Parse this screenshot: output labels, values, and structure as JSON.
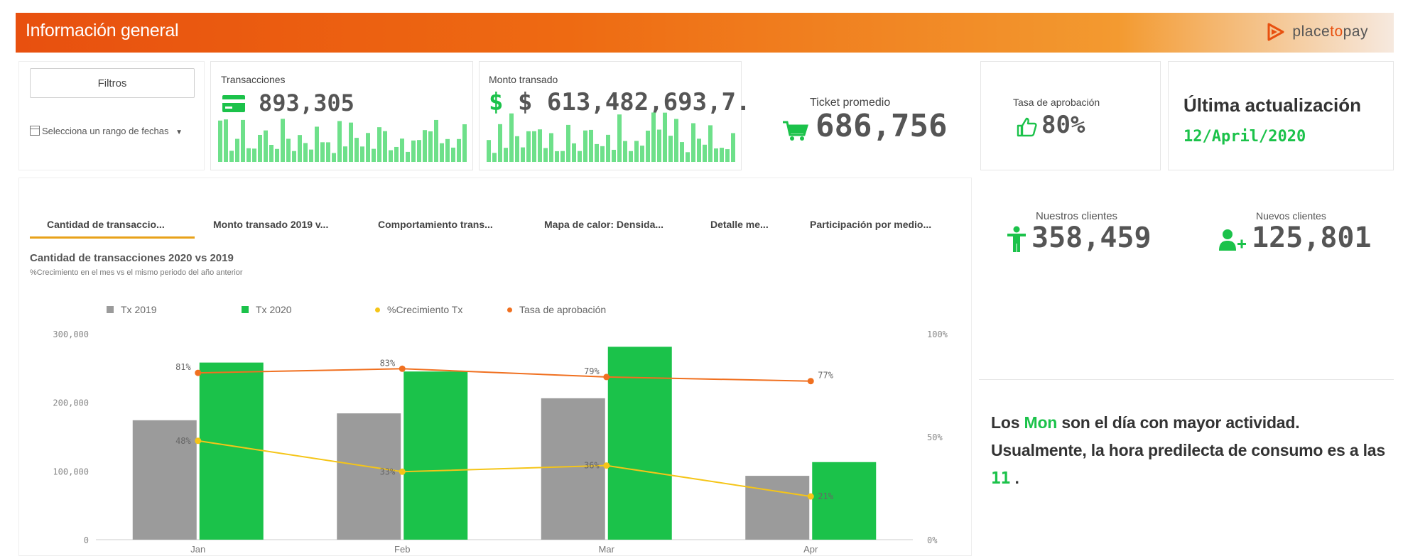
{
  "header": {
    "title": "Información general",
    "brand_pre": "place",
    "brand_mid": "to",
    "brand_post": "pay"
  },
  "filters": {
    "button_label": "Filtros",
    "date_range_label": "Selecciona un rango de fechas"
  },
  "kpis": {
    "transactions": {
      "label": "Transacciones",
      "value": "893,305",
      "icon": "credit-card-icon"
    },
    "amount": {
      "label": "Monto transado",
      "value": "$ 613,482,693,7..."
    },
    "ticket": {
      "label": "Ticket promedio",
      "value": "686,756",
      "icon": "cart-icon"
    },
    "approval": {
      "label": "Tasa de aprobación",
      "value": "80%",
      "icon": "thumbs-up-icon"
    },
    "last_update": {
      "label": "Última actualización",
      "value": "12/April/2020"
    }
  },
  "tabs": [
    {
      "label": "Cantidad de transaccio...",
      "active": true
    },
    {
      "label": "Monto transado 2019 v...",
      "active": false
    },
    {
      "label": "Comportamiento trans...",
      "active": false
    },
    {
      "label": "Mapa de calor: Densida...",
      "active": false
    },
    {
      "label": "Detalle me...",
      "active": false
    },
    {
      "label": "Participación por medio...",
      "active": false
    }
  ],
  "clients": {
    "ours": {
      "label": "Nuestros clientes",
      "value": "358,459",
      "icon": "person-icon"
    },
    "new": {
      "label": "Nuevos clientes",
      "value": "125,801",
      "icon": "add-user-icon"
    }
  },
  "insight": {
    "p1": "Los ",
    "day": "Mon",
    "p2": " son el día con mayor actividad. Usualmente, la hora predilecta de consumo es a las ",
    "hour": "11",
    "p3": " ."
  },
  "colors": {
    "accent": "#e8500f",
    "green": "#1bc24a",
    "gray": "#9b9b9b",
    "yellow": "#f5c518",
    "orange": "#f07020"
  },
  "chart_data": {
    "type": "bar",
    "title": "Cantidad de transacciones 2020 vs 2019",
    "subtitle": "%Crecimiento en el mes vs el mismo periodo del año anterior",
    "categories": [
      "Jan",
      "Feb",
      "Mar",
      "Apr"
    ],
    "ylim": [
      0,
      300000
    ],
    "y_ticks": [
      "300,000",
      "200,000",
      "100,000",
      "0"
    ],
    "y2lim": [
      0,
      100
    ],
    "y2_ticks": [
      "100%",
      "50%",
      "0%"
    ],
    "series": [
      {
        "name": "Tx 2019",
        "kind": "bar",
        "color": "#9b9b9b",
        "values": [
          174000,
          184000,
          206000,
          93000
        ]
      },
      {
        "name": "Tx 2020",
        "kind": "bar",
        "color": "#1bc24a",
        "values": [
          258000,
          245000,
          281000,
          113000
        ]
      },
      {
        "name": "%Crecimiento Tx",
        "kind": "line",
        "axis": "right",
        "color": "#f5c518",
        "values": [
          48,
          33,
          36,
          21
        ],
        "labels": [
          "48%",
          "33%",
          "36%",
          "21%"
        ]
      },
      {
        "name": "Tasa de aprobación",
        "kind": "line",
        "axis": "right",
        "color": "#f07020",
        "values": [
          81,
          83,
          79,
          77
        ],
        "labels": [
          "81%",
          "83%",
          "79%",
          "77%"
        ]
      }
    ],
    "grid": false,
    "legend": "top-left"
  }
}
